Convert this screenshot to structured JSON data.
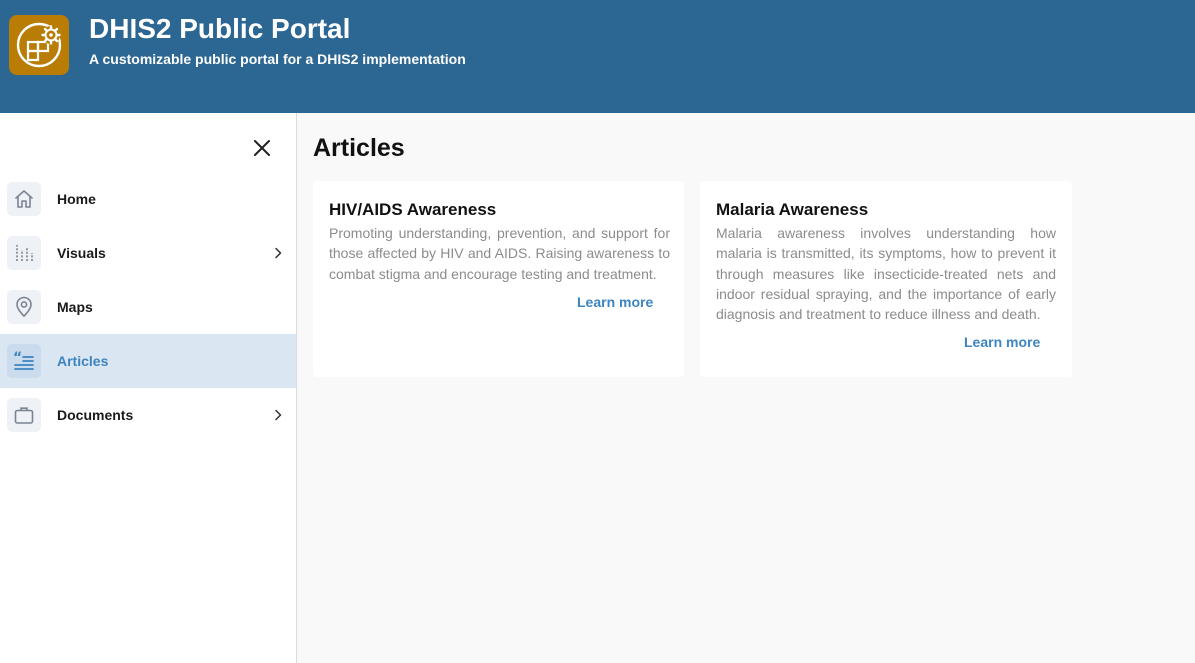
{
  "header": {
    "title": "DHIS2 Public Portal",
    "subtitle": "A customizable public portal for a DHIS2 implementation",
    "logo_icon": "grid-gear-icon",
    "colors": {
      "header_bg": "#2c6693",
      "logo_bg": "#b97d06"
    }
  },
  "sidebar": {
    "close_icon": "close-icon",
    "items": [
      {
        "label": "Home",
        "icon": "home-icon",
        "has_submenu": false,
        "active": false
      },
      {
        "label": "Visuals",
        "icon": "bar-chart-icon",
        "has_submenu": true,
        "active": false
      },
      {
        "label": "Maps",
        "icon": "map-pin-icon",
        "has_submenu": false,
        "active": false
      },
      {
        "label": "Articles",
        "icon": "quote-text-icon",
        "has_submenu": false,
        "active": true
      },
      {
        "label": "Documents",
        "icon": "briefcase-icon",
        "has_submenu": true,
        "active": false
      }
    ],
    "colors": {
      "active_bg": "#dae6f2",
      "active_text": "#3d84c0"
    }
  },
  "main": {
    "title": "Articles",
    "articles": [
      {
        "title": "HIV/AIDS Awareness",
        "description": "Promoting understanding, prevention, and support for those affected by HIV and AIDS. Raising awareness to combat stigma and encourage testing and treatment.",
        "link_label": "Learn more"
      },
      {
        "title": "Malaria Awareness",
        "description": "Malaria awareness involves understanding how malaria is transmitted, its symptoms, how to prevent it through measures like insecticide-treated nets and indoor residual spraying, and the importance of early diagnosis and treatment to reduce illness and death.",
        "link_label": "Learn more"
      }
    ]
  }
}
